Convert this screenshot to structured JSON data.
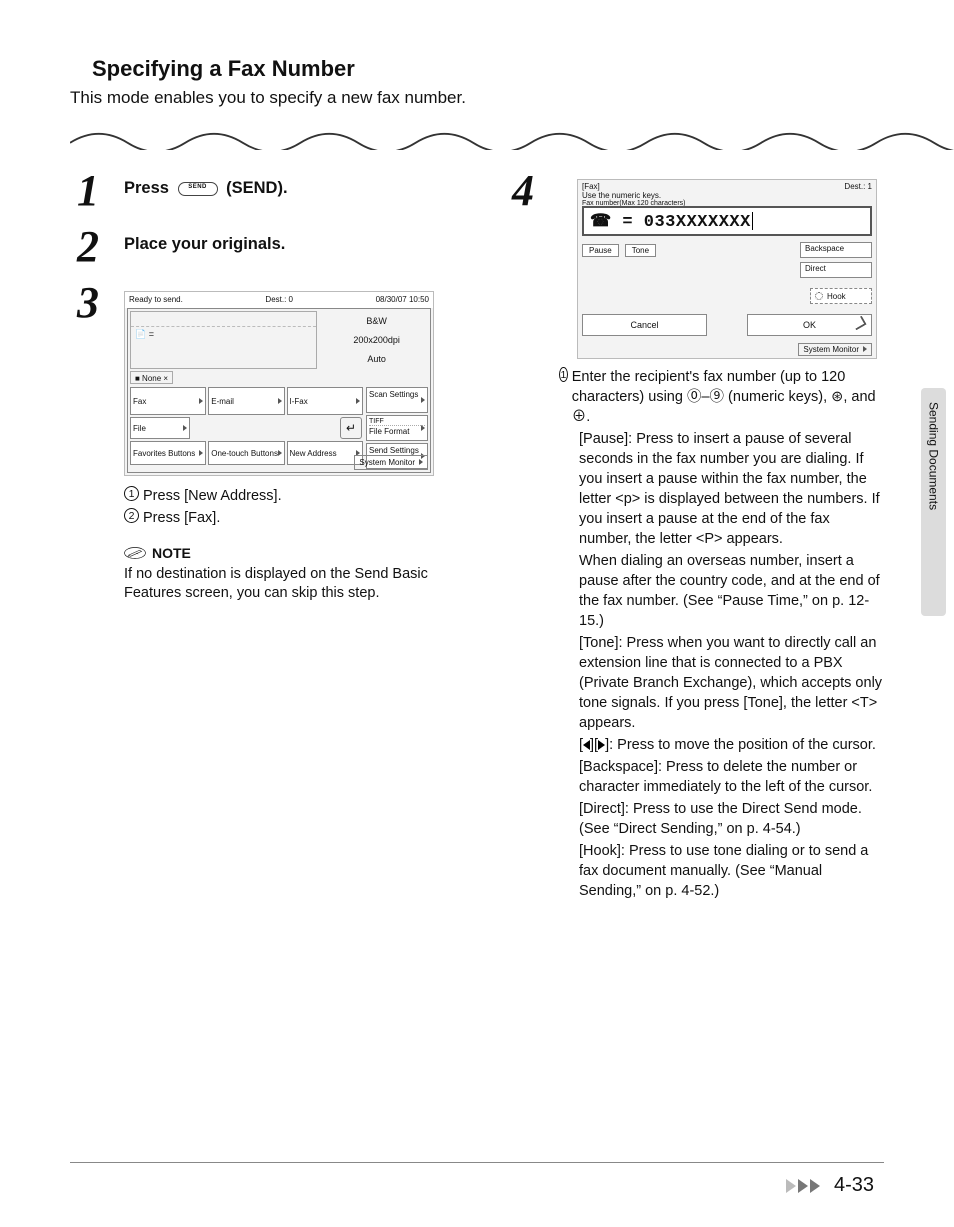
{
  "heading": "Specifying a Fax Number",
  "intro": "This mode enables you to specify a new fax number.",
  "step1_title_a": "Press ",
  "step1_title_b": " (SEND).",
  "step2_title": "Place your originals.",
  "screen1": {
    "ready": "Ready to send.",
    "dest": "Dest.:   0",
    "date": "08/30/07 10:50",
    "bw": "B&W",
    "dpi": "200x200dpi",
    "auto": "Auto",
    "tab": "■ None  ×",
    "btn_fax": "Fax",
    "btn_email": "E-mail",
    "btn_ifax": "I-Fax",
    "btn_file": "File",
    "btn_fav": "Favorites Buttons",
    "btn_one": "One-touch Buttons",
    "btn_new": "New Address",
    "side_scan": "Scan Settings",
    "side_tiff": "TIFF",
    "side_fileformat": "File Format",
    "side_send": "Send Settings",
    "sysmon": "System Monitor"
  },
  "sub1": "Press [New Address].",
  "sub2": "Press [Fax].",
  "note_label": "NOTE",
  "note_body": "If no destination is displayed on the Send Basic Features screen, you can skip this step.",
  "screen2": {
    "faxlab": "[Fax]",
    "usekeys": "Use the numeric keys.",
    "maxline": "Fax number(Max 120 characters)",
    "destcount": "Dest.:  1",
    "entry": "☎ = 033XXXXXXX",
    "pause": "Pause",
    "tone": "Tone",
    "backspace": "Backspace",
    "direct": "Direct",
    "hook": "Hook",
    "cancel": "Cancel",
    "ok": "OK",
    "sysmon": "System Monitor"
  },
  "step4_lead": "Enter the recipient's fax number (up to 120 characters) using ⓪–⑨ (numeric keys), ⊛, and ⊕.",
  "para_pause": "[Pause]: Press to insert a pause of several seconds in the fax number you are dialing. If you insert a pause within the fax number, the letter <p> is displayed between the numbers. If you insert a pause at the end of the fax number, the letter <P> appears.",
  "para_overseas": "When dialing an overseas number, insert a pause after the country code, and at the end of the fax number. (See “Pause Time,” on p. 12-15.)",
  "para_tone": "[Tone]: Press when you want to directly call an extension line that is connected to a PBX (Private Branch Exchange), which accepts only tone signals. If you press [Tone], the letter <T> appears.",
  "para_arrows_a": "[",
  "para_arrows_mid": "][",
  "para_arrows_b": "]: Press to move the position of the cursor.",
  "para_backspace": "[Backspace]: Press to delete the number or character immediately to the left of the cursor.",
  "para_direct": "[Direct]: Press to use the Direct Send mode. (See “Direct Sending,” on p. 4-54.)",
  "para_hook": "[Hook]: Press to use tone dialing or to send a fax document manually. (See “Manual Sending,” on p. 4-52.)",
  "sidetab": "Sending Documents",
  "pagenum": "4-33"
}
